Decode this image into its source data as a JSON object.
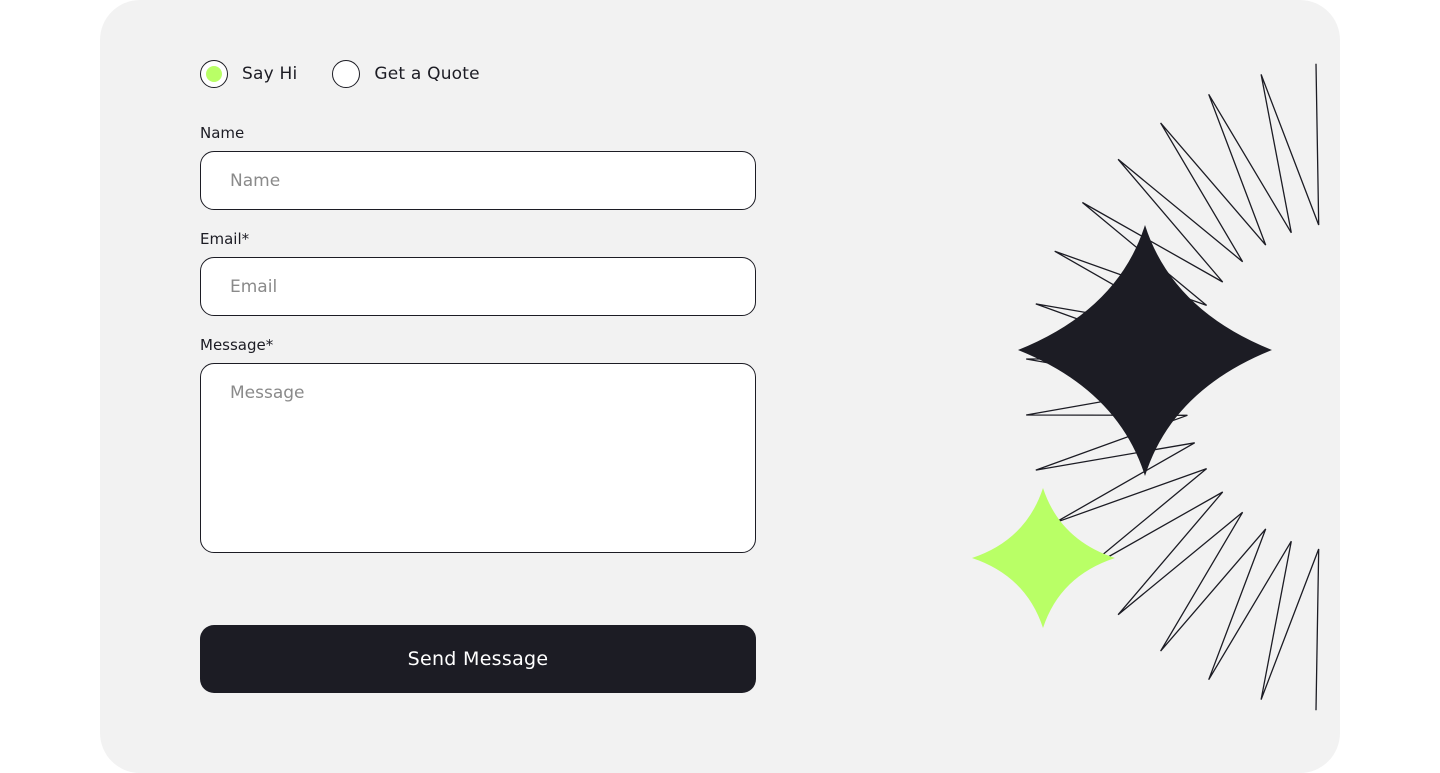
{
  "contact_type": {
    "options": [
      {
        "label": "Say Hi",
        "selected": true
      },
      {
        "label": "Get a Quote",
        "selected": false
      }
    ]
  },
  "form": {
    "name": {
      "label": "Name",
      "placeholder": "Name",
      "value": ""
    },
    "email": {
      "label": "Email*",
      "placeholder": "Email",
      "value": ""
    },
    "message": {
      "label": "Message*",
      "placeholder": "Message",
      "value": ""
    },
    "submit_label": "Send Message"
  },
  "illustration": {
    "large_star_color": "#1c1c24",
    "small_star_color": "#b9ff66",
    "rays_icon": "burst-rays-icon"
  },
  "colors": {
    "card_background": "#f2f2f2",
    "accent": "#b9ff66",
    "dark": "#1c1c24"
  }
}
